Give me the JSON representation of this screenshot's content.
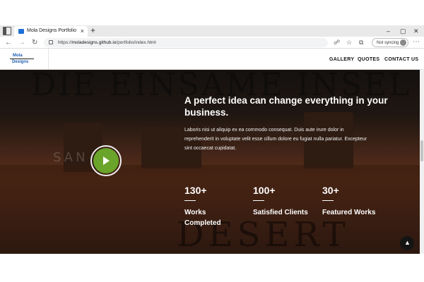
{
  "browser": {
    "tab_title": "Mola Designs Portfolio",
    "tab_close": "×",
    "new_tab": "+",
    "url_prefix": "https://",
    "url_host": "moladesigns.github.io",
    "url_path": "/portfolio/index.html",
    "sync_label": "Not syncing",
    "window_controls": [
      "–",
      "▢",
      "✕"
    ]
  },
  "site": {
    "logo_top": "Mola",
    "logo_bottom": "Designs",
    "nav": [
      "GALLERY",
      "QUOTES",
      "CONTACT US"
    ]
  },
  "hero": {
    "bg_title": "DIE EINSAME INSEL",
    "bg_word_left": "SAN",
    "bg_word_bottom": "DESERT",
    "headline": "A perfect idea can change everything in your business.",
    "paragraph": "Laboris nisi ut aliquip ex ea commodo consequat. Duis aute irure dolor in reprehenderit in voluptate velit esse cillum dolore eu fugiat nulla pariatur. Excepteur sint occaecat cupidatat.",
    "stats": [
      {
        "number": "130+",
        "label": "Works Completed"
      },
      {
        "number": "100+",
        "label": "Satisfied Clients"
      },
      {
        "number": "30+",
        "label": "Featured Works"
      }
    ]
  },
  "colors": {
    "play_button": "#6aa42b",
    "logo_blue": "#1f5fb0"
  }
}
